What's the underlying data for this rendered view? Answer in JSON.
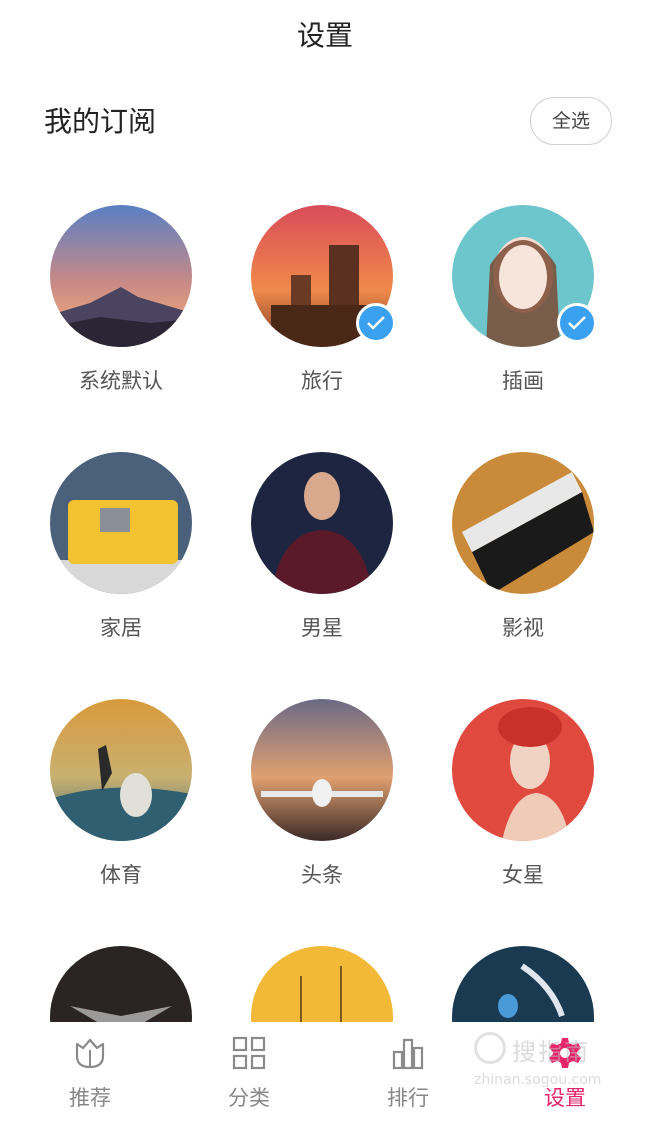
{
  "header": {
    "title": "设置"
  },
  "subscriptions": {
    "title": "我的订阅",
    "select_all_label": "全选",
    "items": [
      {
        "label": "系统默认",
        "checked": false
      },
      {
        "label": "旅行",
        "checked": true
      },
      {
        "label": "插画",
        "checked": true
      },
      {
        "label": "家居",
        "checked": false
      },
      {
        "label": "男星",
        "checked": false
      },
      {
        "label": "影视",
        "checked": false
      },
      {
        "label": "体育",
        "checked": false
      },
      {
        "label": "头条",
        "checked": false
      },
      {
        "label": "女星",
        "checked": false
      }
    ]
  },
  "tabbar": {
    "items": [
      {
        "label": "推荐",
        "icon": "tulip-icon",
        "active": false
      },
      {
        "label": "分类",
        "icon": "grid-icon",
        "active": false
      },
      {
        "label": "排行",
        "icon": "bar-chart-icon",
        "active": false
      },
      {
        "label": "设置",
        "icon": "gear-icon",
        "active": true
      }
    ]
  },
  "watermark": {
    "main": "搜指南",
    "sub": "zhinan.sogou.com"
  },
  "colors": {
    "accent": "#e8246a",
    "check": "#3aa0f0"
  }
}
